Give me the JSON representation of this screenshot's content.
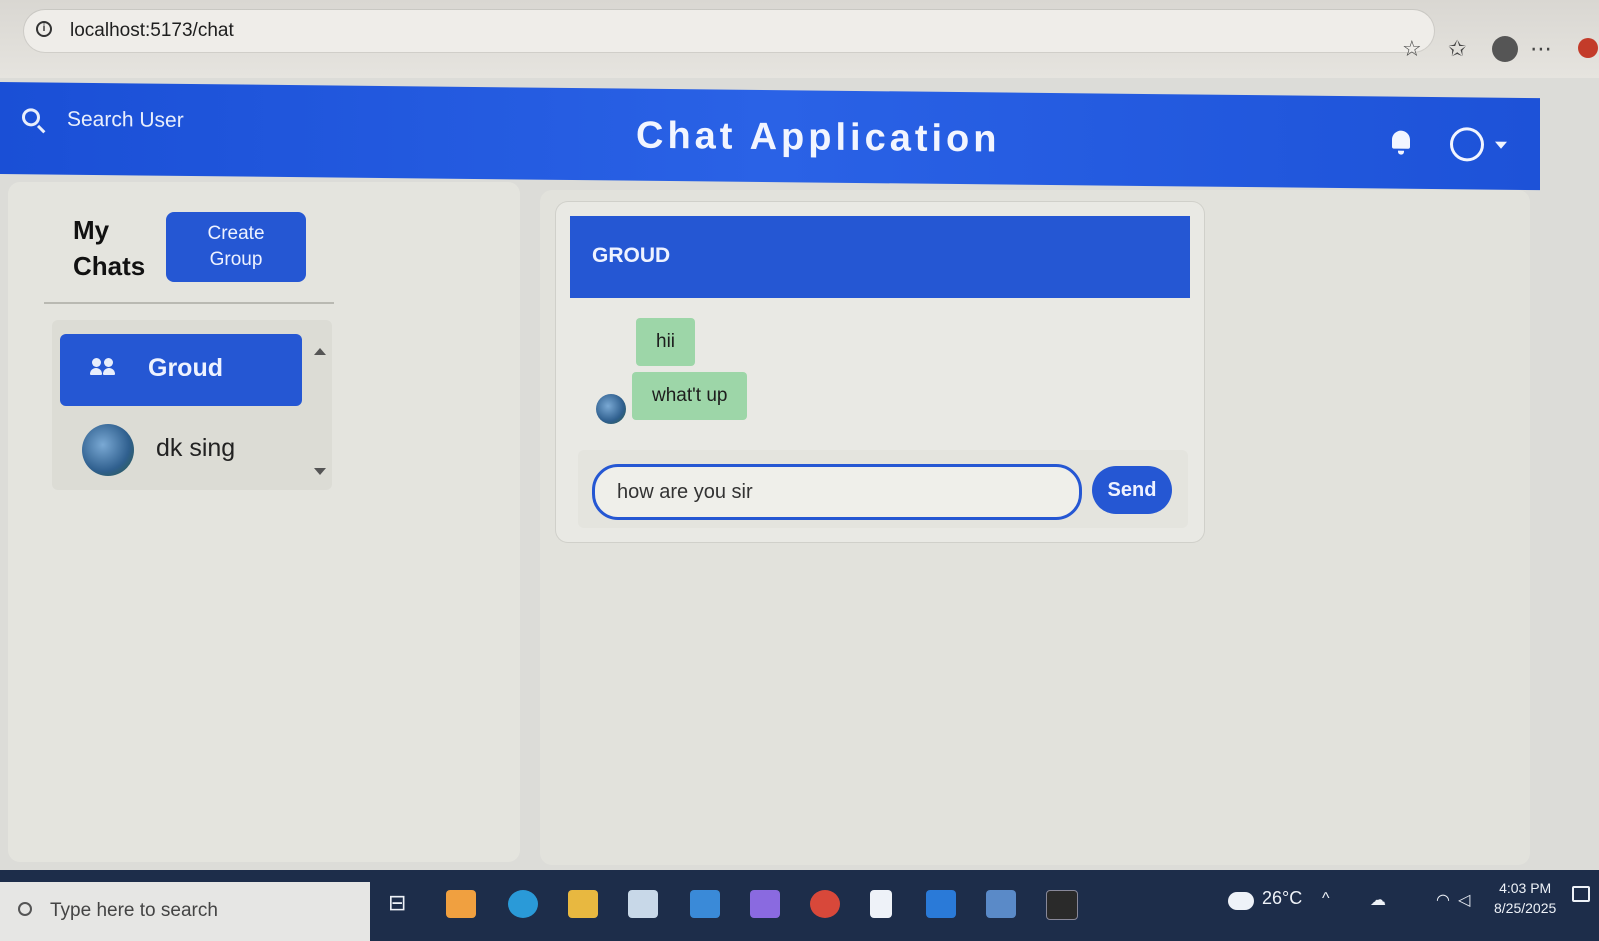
{
  "browser": {
    "url": "localhost:5173/chat"
  },
  "header": {
    "search_label": "Search User",
    "title": "Chat Application"
  },
  "sidebar": {
    "heading_line1": "My",
    "heading_line2": "Chats",
    "create_group_line1": "Create",
    "create_group_line2": "Group",
    "chats": [
      {
        "label": "Groud",
        "selected": true
      },
      {
        "label": "dk sing",
        "selected": false
      }
    ]
  },
  "chat": {
    "title": "GROUD",
    "messages": [
      {
        "text": "hii"
      },
      {
        "text": "what't up"
      }
    ],
    "input_value": "how are you sir",
    "send_label": "Send"
  },
  "taskbar": {
    "search_placeholder": "Type here to search",
    "temperature": "26°C",
    "time": "4:03 PM",
    "date": "8/25/2025"
  },
  "colors": {
    "accent": "#2557d3",
    "bubble": "#9dd6a8"
  }
}
